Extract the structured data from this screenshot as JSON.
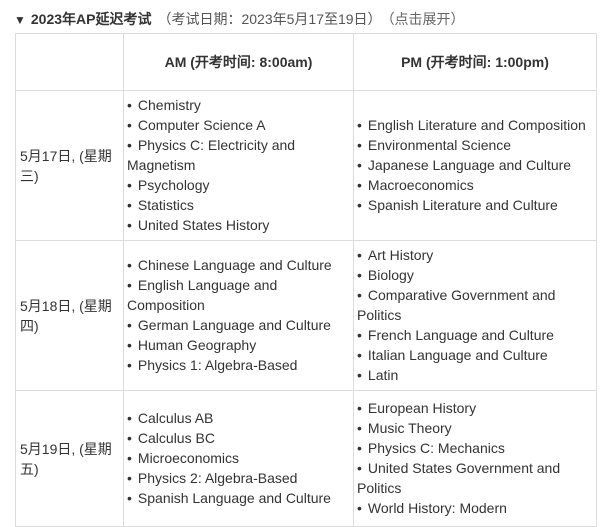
{
  "header": {
    "arrow": "▼",
    "title": "2023年AP延迟考试",
    "dates": "（考试日期：2023年5月17至19日）",
    "toggle": "（点击展开）"
  },
  "table": {
    "columns": [
      "",
      "AM (开考时间: 8:00am)",
      "PM (开考时间: 1:00pm)"
    ],
    "rows": [
      {
        "date": "5月17日, (星期三)",
        "am": [
          "Chemistry",
          "Computer Science A",
          "Physics C: Electricity and Magnetism",
          "Psychology",
          "Statistics",
          "United States History"
        ],
        "pm": [
          "English Literature and Composition",
          "Environmental Science",
          "Japanese Language and Culture",
          "Macroeconomics",
          "Spanish Literature and Culture"
        ]
      },
      {
        "date": "5月18日, (星期四)",
        "am": [
          "Chinese Language and Culture",
          "English Language and Composition",
          "German Language and Culture",
          "Human Geography",
          "Physics 1: Algebra-Based"
        ],
        "pm": [
          "Art History",
          "Biology",
          "Comparative Government and Politics",
          "French Language and Culture",
          "Italian Language and Culture",
          "Latin"
        ]
      },
      {
        "date": "5月19日, (星期五)",
        "am": [
          "Calculus AB",
          "Calculus BC",
          "Microeconomics",
          "Physics 2: Algebra-Based",
          "Spanish Language and Culture"
        ],
        "pm": [
          "European History",
          "Music Theory",
          "Physics C: Mechanics",
          "United States Government and Politics",
          "World History: Modern"
        ]
      }
    ]
  }
}
